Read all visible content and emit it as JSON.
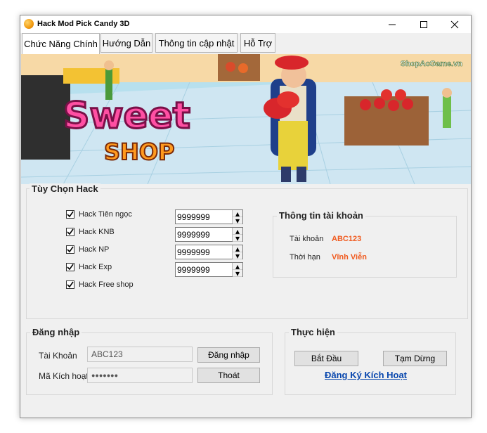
{
  "window": {
    "title": "Hack Mod Pick Candy 3D"
  },
  "tabs": [
    {
      "label": "Chức Năng Chính"
    },
    {
      "label": "Hướng Dẫn"
    },
    {
      "label": "Thông tin cập nhật"
    },
    {
      "label": "Hỗ Trợ"
    }
  ],
  "banner": {
    "logo_line1": "Sweet",
    "logo_line2": "SHOP",
    "watermark": "ShopAcGame.vn"
  },
  "hack_options": {
    "title": "Tùy Chọn Hack",
    "items": [
      {
        "label": "Hack Tiên ngọc",
        "checked": true,
        "value": "9999999"
      },
      {
        "label": "Hack KNB",
        "checked": true,
        "value": "9999999"
      },
      {
        "label": "Hack NP",
        "checked": true,
        "value": "9999999"
      },
      {
        "label": "Hack Exp",
        "checked": true,
        "value": "9999999"
      },
      {
        "label": "Hack Free shop",
        "checked": true
      }
    ]
  },
  "account_info": {
    "title": "Thông tin tài khoản",
    "account_label": "Tài khoản",
    "account_value": "ABC123",
    "expiry_label": "Thời hạn",
    "expiry_value": "Vĩnh Viễn"
  },
  "login": {
    "title": "Đăng nhập",
    "account_label": "Tài Khoản",
    "account_value": "ABC123",
    "code_label": "Mã Kích hoạt",
    "code_value": "●●●●●●●",
    "login_button": "Đăng nhập",
    "exit_button": "Thoát"
  },
  "actions": {
    "title": "Thực hiện",
    "start_button": "Bắt Đầu",
    "pause_button": "Tạm Dừng",
    "register_link": "Đăng Ký Kích Hoạt"
  },
  "colors": {
    "accent": "#f05a1e",
    "link": "#0645ad"
  }
}
